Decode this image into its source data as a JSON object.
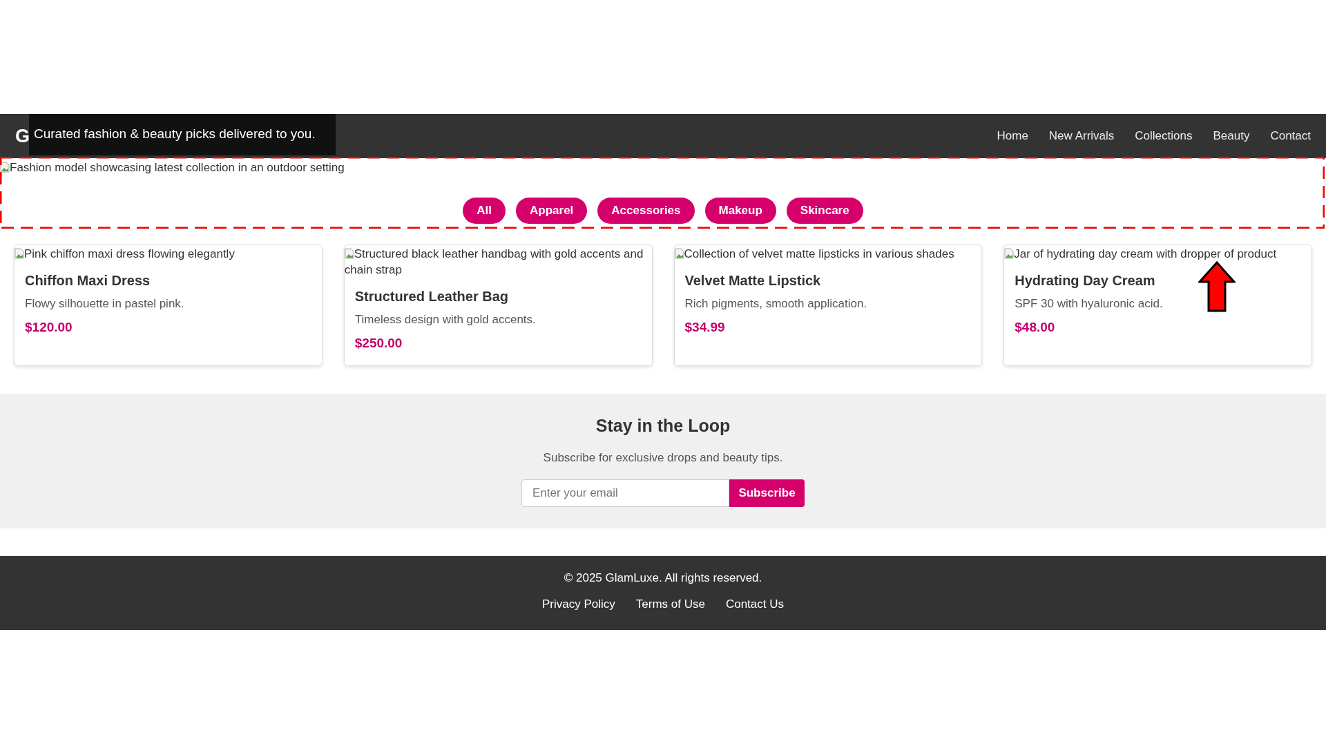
{
  "header": {
    "logo": "G",
    "nav": [
      "Home",
      "New Arrivals",
      "Collections",
      "Beauty",
      "Contact"
    ]
  },
  "tooltip": {
    "text": "Curated fashion & beauty picks delivered to you."
  },
  "hero": {
    "image_alt": "Fashion model showcasing latest collection in an outdoor setting",
    "filters": [
      "All",
      "Apparel",
      "Accessories",
      "Makeup",
      "Skincare"
    ]
  },
  "products": [
    {
      "image_alt": "Pink chiffon maxi dress flowing elegantly",
      "name": "Chiffon Maxi Dress",
      "description": "Flowy silhouette in pastel pink.",
      "price": "$120.00"
    },
    {
      "image_alt": "Structured black leather handbag with gold accents and chain strap",
      "name": "Structured Leather Bag",
      "description": "Timeless design with gold accents.",
      "price": "$250.00"
    },
    {
      "image_alt": "Collection of velvet matte lipsticks in various shades",
      "name": "Velvet Matte Lipstick",
      "description": "Rich pigments, smooth application.",
      "price": "$34.99"
    },
    {
      "image_alt": "Jar of hydrating day cream with dropper of product",
      "name": "Hydrating Day Cream",
      "description": "SPF 30 with hyaluronic acid.",
      "price": "$48.00"
    }
  ],
  "newsletter": {
    "title": "Stay in the Loop",
    "text": "Subscribe for exclusive drops and beauty tips.",
    "placeholder": "Enter your email",
    "button": "Subscribe"
  },
  "footer": {
    "copyright": "© 2025 GlamLuxe. All rights reserved.",
    "links": [
      "Privacy Policy",
      "Terms of Use",
      "Contact Us"
    ]
  }
}
